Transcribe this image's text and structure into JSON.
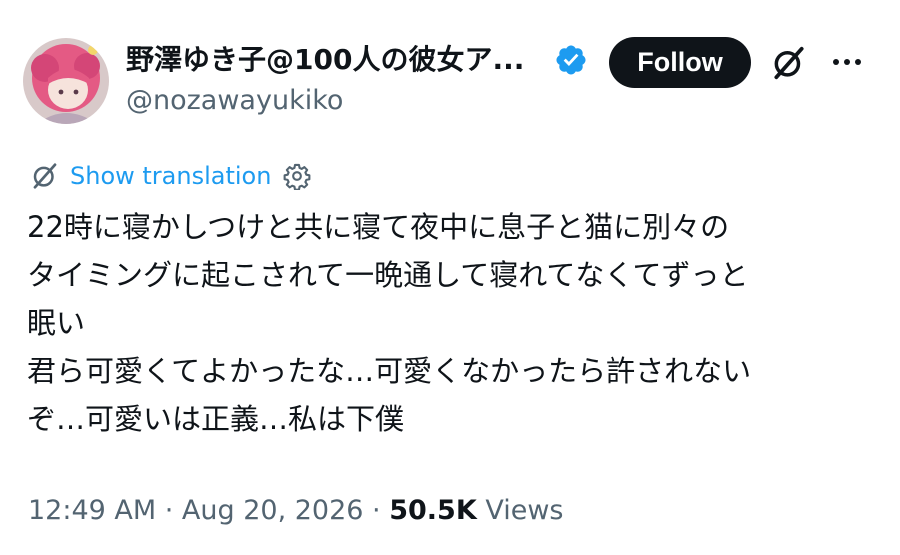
{
  "author": {
    "display_name": "野澤ゆき子@100人の彼女ア...",
    "handle": "@nozawayukiko",
    "verified": true,
    "avatar_icon": "avatar-illustration"
  },
  "actions": {
    "follow_label": "Follow",
    "grok_icon": "grok-icon",
    "more_icon": "more-dots-icon"
  },
  "translation": {
    "label": "Show translation",
    "settings_icon": "gear-icon"
  },
  "tweet": {
    "lines": [
      "22時に寝かしつけと共に寝て夜中に息子と猫に別々の",
      "タイミングに起こされて一晩通して寝れてなくてずっと",
      "眠い",
      "君ら可愛くてよかったな…可愛くなかったら許されない",
      "ぞ…可愛いは正義…私は下僕"
    ]
  },
  "meta": {
    "time": "12:49 AM",
    "separator1": " · ",
    "date": "Aug 20, 2026",
    "separator2": " · ",
    "views_count": "50.5K",
    "views_label": " Views"
  },
  "colors": {
    "link": "#1d9bf0",
    "verified": "#1d9bf0",
    "secondary_text": "#536471",
    "primary_text": "#0f1419",
    "follow_bg": "#0f1419"
  }
}
